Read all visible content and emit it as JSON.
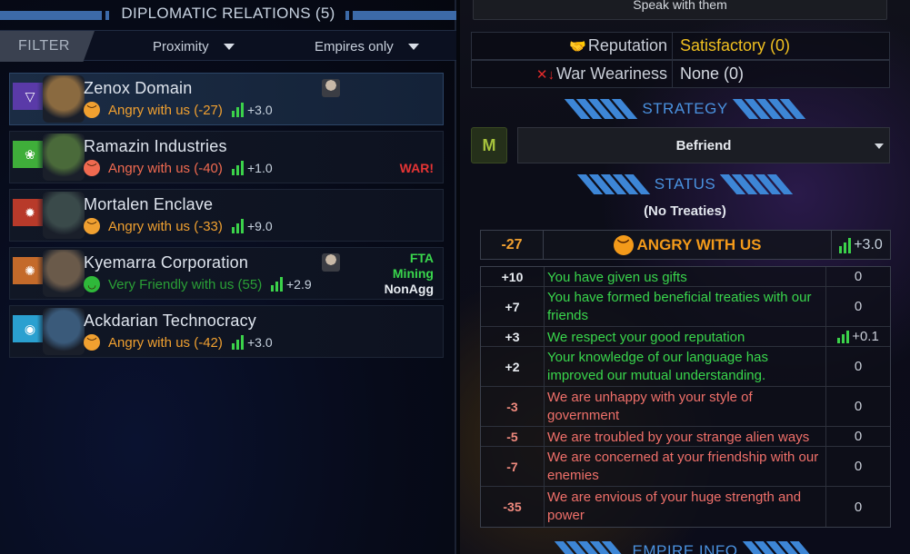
{
  "left": {
    "title": "DIPLOMATIC RELATIONS (5)",
    "filter": {
      "label": "FILTER",
      "proximity": "Proximity",
      "empires_only": "Empires only"
    },
    "empires": [
      {
        "name": "Zenox Domain",
        "mood": "Angry with us (-27)",
        "mood_color": "#f0a030",
        "trend": "+3.0",
        "flag_bg": "#5a3aa8",
        "flag_glyph": "▽",
        "portrait_bg": "#8a6a40",
        "has_avatar": true,
        "war": "",
        "treaties": []
      },
      {
        "name": "Ramazin Industries",
        "mood": "Angry with us (-40)",
        "mood_color": "#f06a50",
        "trend": "+1.0",
        "flag_bg": "#3fae3a",
        "flag_glyph": "❀",
        "portrait_bg": "#4a6a3a",
        "has_avatar": false,
        "war": "WAR!",
        "treaties": []
      },
      {
        "name": "Mortalen Enclave",
        "mood": "Angry with us (-33)",
        "mood_color": "#f0a030",
        "trend": "+9.0",
        "flag_bg": "#b83a2a",
        "flag_glyph": "✹",
        "portrait_bg": "#3a4a4a",
        "has_avatar": false,
        "war": "",
        "treaties": []
      },
      {
        "name": "Kyemarra Corporation",
        "mood": "Very Friendly with us (55)",
        "mood_color": "#2fb83a",
        "trend": "+2.9",
        "flag_bg": "#c46a2a",
        "flag_glyph": "✺",
        "portrait_bg": "#6a5a4a",
        "has_avatar": true,
        "war": "",
        "treaties": [
          {
            "label": "FTA",
            "color": "#39d64c"
          },
          {
            "label": "Mining",
            "color": "#39d64c"
          },
          {
            "label": "NonAgg",
            "color": "#e7ebf0"
          }
        ]
      },
      {
        "name": "Ackdarian Technocracy",
        "mood": "Angry with us (-42)",
        "mood_color": "#f0a030",
        "trend": "+3.0",
        "flag_bg": "#2aa0d0",
        "flag_glyph": "◉",
        "portrait_bg": "#3a5a7a",
        "has_avatar": false,
        "war": "",
        "treaties": []
      }
    ]
  },
  "right": {
    "speak_button": "Speak with them",
    "reputation_label": "Reputation",
    "reputation_value": "Satisfactory (0)",
    "war_weariness_label": "War Weariness",
    "war_weariness_value": "None (0)",
    "strategy_title": "STRATEGY",
    "strategy_icon": "M",
    "strategy_value": "Befriend",
    "status_title": "STATUS",
    "treaties_text": "(No Treaties)",
    "opinion_value": "-27",
    "opinion_status": "ANGRY WITH US",
    "opinion_trend": "+3.0",
    "modifiers": [
      {
        "value": "+10",
        "text": "You have given us gifts",
        "trend": "0",
        "positive": true
      },
      {
        "value": "+7",
        "text": "You have formed beneficial treaties with our friends",
        "trend": "0",
        "positive": true
      },
      {
        "value": "+3",
        "text": "We respect your good reputation",
        "trend": "+0.1",
        "positive": true
      },
      {
        "value": "+2",
        "text": "Your knowledge of our language has improved our mutual understanding.",
        "trend": "0",
        "positive": true
      },
      {
        "value": "-3",
        "text": "We are unhappy with your style of government",
        "trend": "0",
        "positive": false
      },
      {
        "value": "-5",
        "text": "We are troubled by your strange alien ways",
        "trend": "0",
        "positive": false
      },
      {
        "value": "-7",
        "text": "We are concerned at your friendship with our enemies",
        "trend": "0",
        "positive": false
      },
      {
        "value": "-35",
        "text": "We are envious of your huge strength and power",
        "trend": "0",
        "positive": false
      }
    ],
    "empire_info_title": "EMPIRE INFO"
  }
}
